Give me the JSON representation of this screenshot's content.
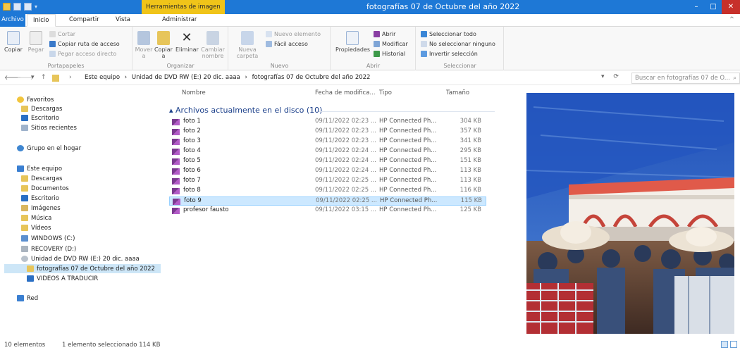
{
  "window": {
    "title": "fotografías 07 de Octubre del año 2022",
    "contextual_tab": "Herramientas de imagen",
    "minimize": "–",
    "maximize": "□",
    "close": "✕",
    "ribbon_toggle": "^"
  },
  "tabs": {
    "file": "Archivo",
    "home": "Inicio",
    "share": "Compartir",
    "view": "Vista",
    "manage": "Administrar"
  },
  "ribbon": {
    "clipboard": {
      "label": "Portapapeles",
      "copy": "Copiar",
      "paste": "Pegar",
      "cut": "Cortar",
      "copy_path": "Copiar ruta de acceso",
      "paste_shortcut": "Pegar acceso directo"
    },
    "organize": {
      "label": "Organizar",
      "move_to": "Mover a",
      "copy_to": "Copiar a",
      "delete": "Eliminar",
      "rename": "Cambiar nombre"
    },
    "new": {
      "label": "Nuevo",
      "new_folder": "Nueva carpeta",
      "new_item": "Nuevo elemento",
      "easy_access": "Fácil acceso"
    },
    "open": {
      "label": "Abrir",
      "properties": "Propiedades",
      "open": "Abrir",
      "edit": "Modificar",
      "history": "Historial"
    },
    "select": {
      "label": "Seleccionar",
      "select_all": "Seleccionar todo",
      "select_none": "No seleccionar ninguno",
      "invert": "Invertir selección"
    }
  },
  "address": {
    "back": "🡐",
    "forward": "🡒",
    "dropdown": "▾",
    "up": "↑",
    "crumbs": [
      "Este equipo",
      "Unidad de DVD RW (E:) 20 dic. aaaa",
      "fotografías 07 de Octubre del año 2022"
    ],
    "separator": "›",
    "search_placeholder": "Buscar en fotografías 07 de O..."
  },
  "nav": {
    "favorites": "Favoritos",
    "downloads": "Descargas",
    "desktop": "Escritorio",
    "recent": "Sitios recientes",
    "homegroup": "Grupo en el hogar",
    "this_pc": "Este equipo",
    "pc_items": [
      "Descargas",
      "Documentos",
      "Escritorio",
      "Imágenes",
      "Música",
      "Vídeos",
      "WINDOWS (C:)",
      "RECOVERY (D:)",
      "Unidad de DVD RW (E:) 20 dic. aaaa"
    ],
    "current_folder": "fotografías 07 de Octubre del año 2022",
    "other_folder": "VIDEOS A TRADUCIR",
    "network": "Red"
  },
  "columns": {
    "name": "Nombre",
    "date": "Fecha de modifica...",
    "type": "Tipo",
    "size": "Tamaño"
  },
  "group_header": "Archivos actualmente en el disco (10)",
  "files": [
    {
      "name": "foto 1",
      "date": "09/11/2022 02:23 ...",
      "type": "HP Connected Ph...",
      "size": "304 KB"
    },
    {
      "name": "foto 2",
      "date": "09/11/2022 02:23 ...",
      "type": "HP Connected Ph...",
      "size": "357 KB"
    },
    {
      "name": "foto 3",
      "date": "09/11/2022 02:23 ...",
      "type": "HP Connected Ph...",
      "size": "341 KB"
    },
    {
      "name": "foto 4",
      "date": "09/11/2022 02:24 ...",
      "type": "HP Connected Ph...",
      "size": "295 KB"
    },
    {
      "name": "foto 5",
      "date": "09/11/2022 02:24 ...",
      "type": "HP Connected Ph...",
      "size": "151 KB"
    },
    {
      "name": "foto 6",
      "date": "09/11/2022 02:24 ...",
      "type": "HP Connected Ph...",
      "size": "113 KB"
    },
    {
      "name": "foto 7",
      "date": "09/11/2022 02:25 ...",
      "type": "HP Connected Ph...",
      "size": "113 KB"
    },
    {
      "name": "foto 8",
      "date": "09/11/2022 02:25 ...",
      "type": "HP Connected Ph...",
      "size": "116 KB"
    },
    {
      "name": "foto 9",
      "date": "09/11/2022 02:25 ...",
      "type": "HP Connected Ph...",
      "size": "115 KB"
    },
    {
      "name": "profesor fausto",
      "date": "09/11/2022 03:15 ...",
      "type": "HP Connected Ph...",
      "size": "125 KB"
    }
  ],
  "selected_file": "foto 9",
  "status": {
    "count": "10 elementos",
    "selection": "1 elemento seleccionado  114 KB"
  },
  "colors": {
    "accent": "#1e78d6",
    "context_tab": "#f0c419",
    "selection": "#cce8ff"
  }
}
